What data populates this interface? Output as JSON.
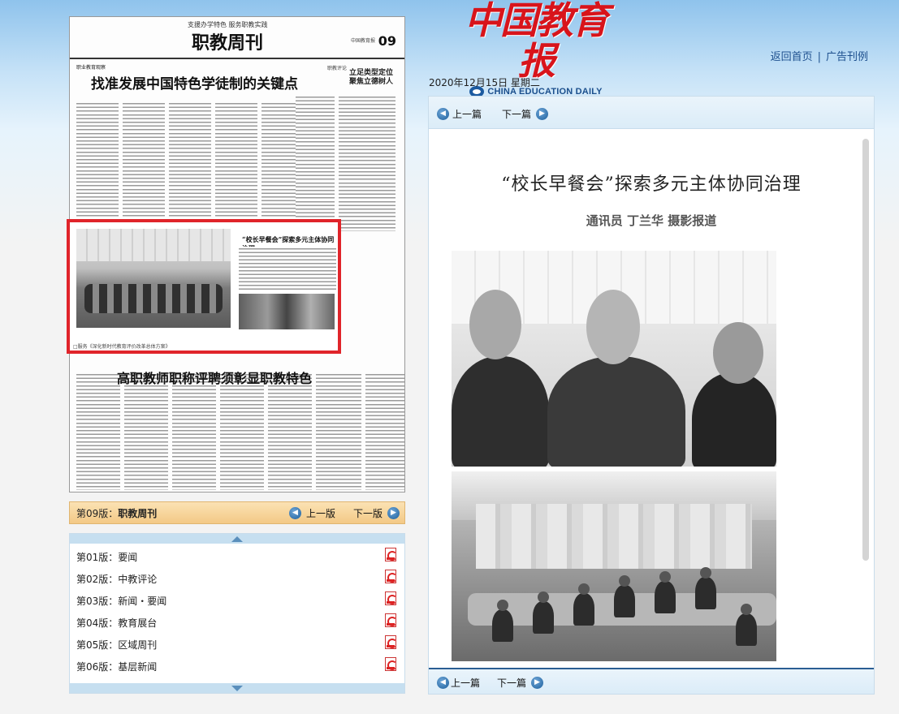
{
  "header": {
    "masthead_cn": "中国教育报",
    "masthead_en": "CHINA EDUCATION DAILY",
    "links": {
      "home": "返回首页",
      "sep": "|",
      "ads": "广告刊例"
    }
  },
  "newspaper": {
    "slogan": "支援办学特色 服务职教实践",
    "section_title": "职教周刊",
    "page_no": "09",
    "paper_name": "中国教育报",
    "kicker": "职业教育观察",
    "headline1": "找准发展中国特色学徒制的关键点",
    "commentary_label": "职教评论",
    "side_headline": [
      "立足类型定位",
      "聚焦立德树人"
    ],
    "highlight": {
      "headline": "“校长早餐会”探索多元主体协同治理",
      "caption": "□服务《深化新时代教育评价改革总体方案》"
    },
    "headline2": "高职教师职称评聘须彰显职教特色"
  },
  "edition_nav": {
    "current_prefix": "第09版：",
    "current_name": "职教周刊",
    "prev": "上一版",
    "next": "下一版"
  },
  "pages": [
    {
      "label": "第01版：要闻"
    },
    {
      "label": "第02版：中教评论"
    },
    {
      "label": "第03版：新闻・要闻"
    },
    {
      "label": "第04版：教育展台"
    },
    {
      "label": "第05版：区域周刊"
    },
    {
      "label": "第06版：基层新闻"
    }
  ],
  "date": "2020年12月15日 星期二",
  "article": {
    "prev": "上一篇",
    "next": "下一篇",
    "title": "“校长早餐会”探索多元主体协同治理",
    "author": "通讯员 丁兰华 摄影报道"
  },
  "icons": {
    "prev_icon": "arrow-left-circle",
    "next_icon": "arrow-right-circle",
    "pdf_icon": "pdf-file",
    "logo_icon": "china-education-daily-logo"
  },
  "colors": {
    "masthead_red": "#d8141b",
    "link_blue": "#1d4f8e",
    "highlight_border": "#e0242a",
    "edition_bar": "#f3c986"
  }
}
